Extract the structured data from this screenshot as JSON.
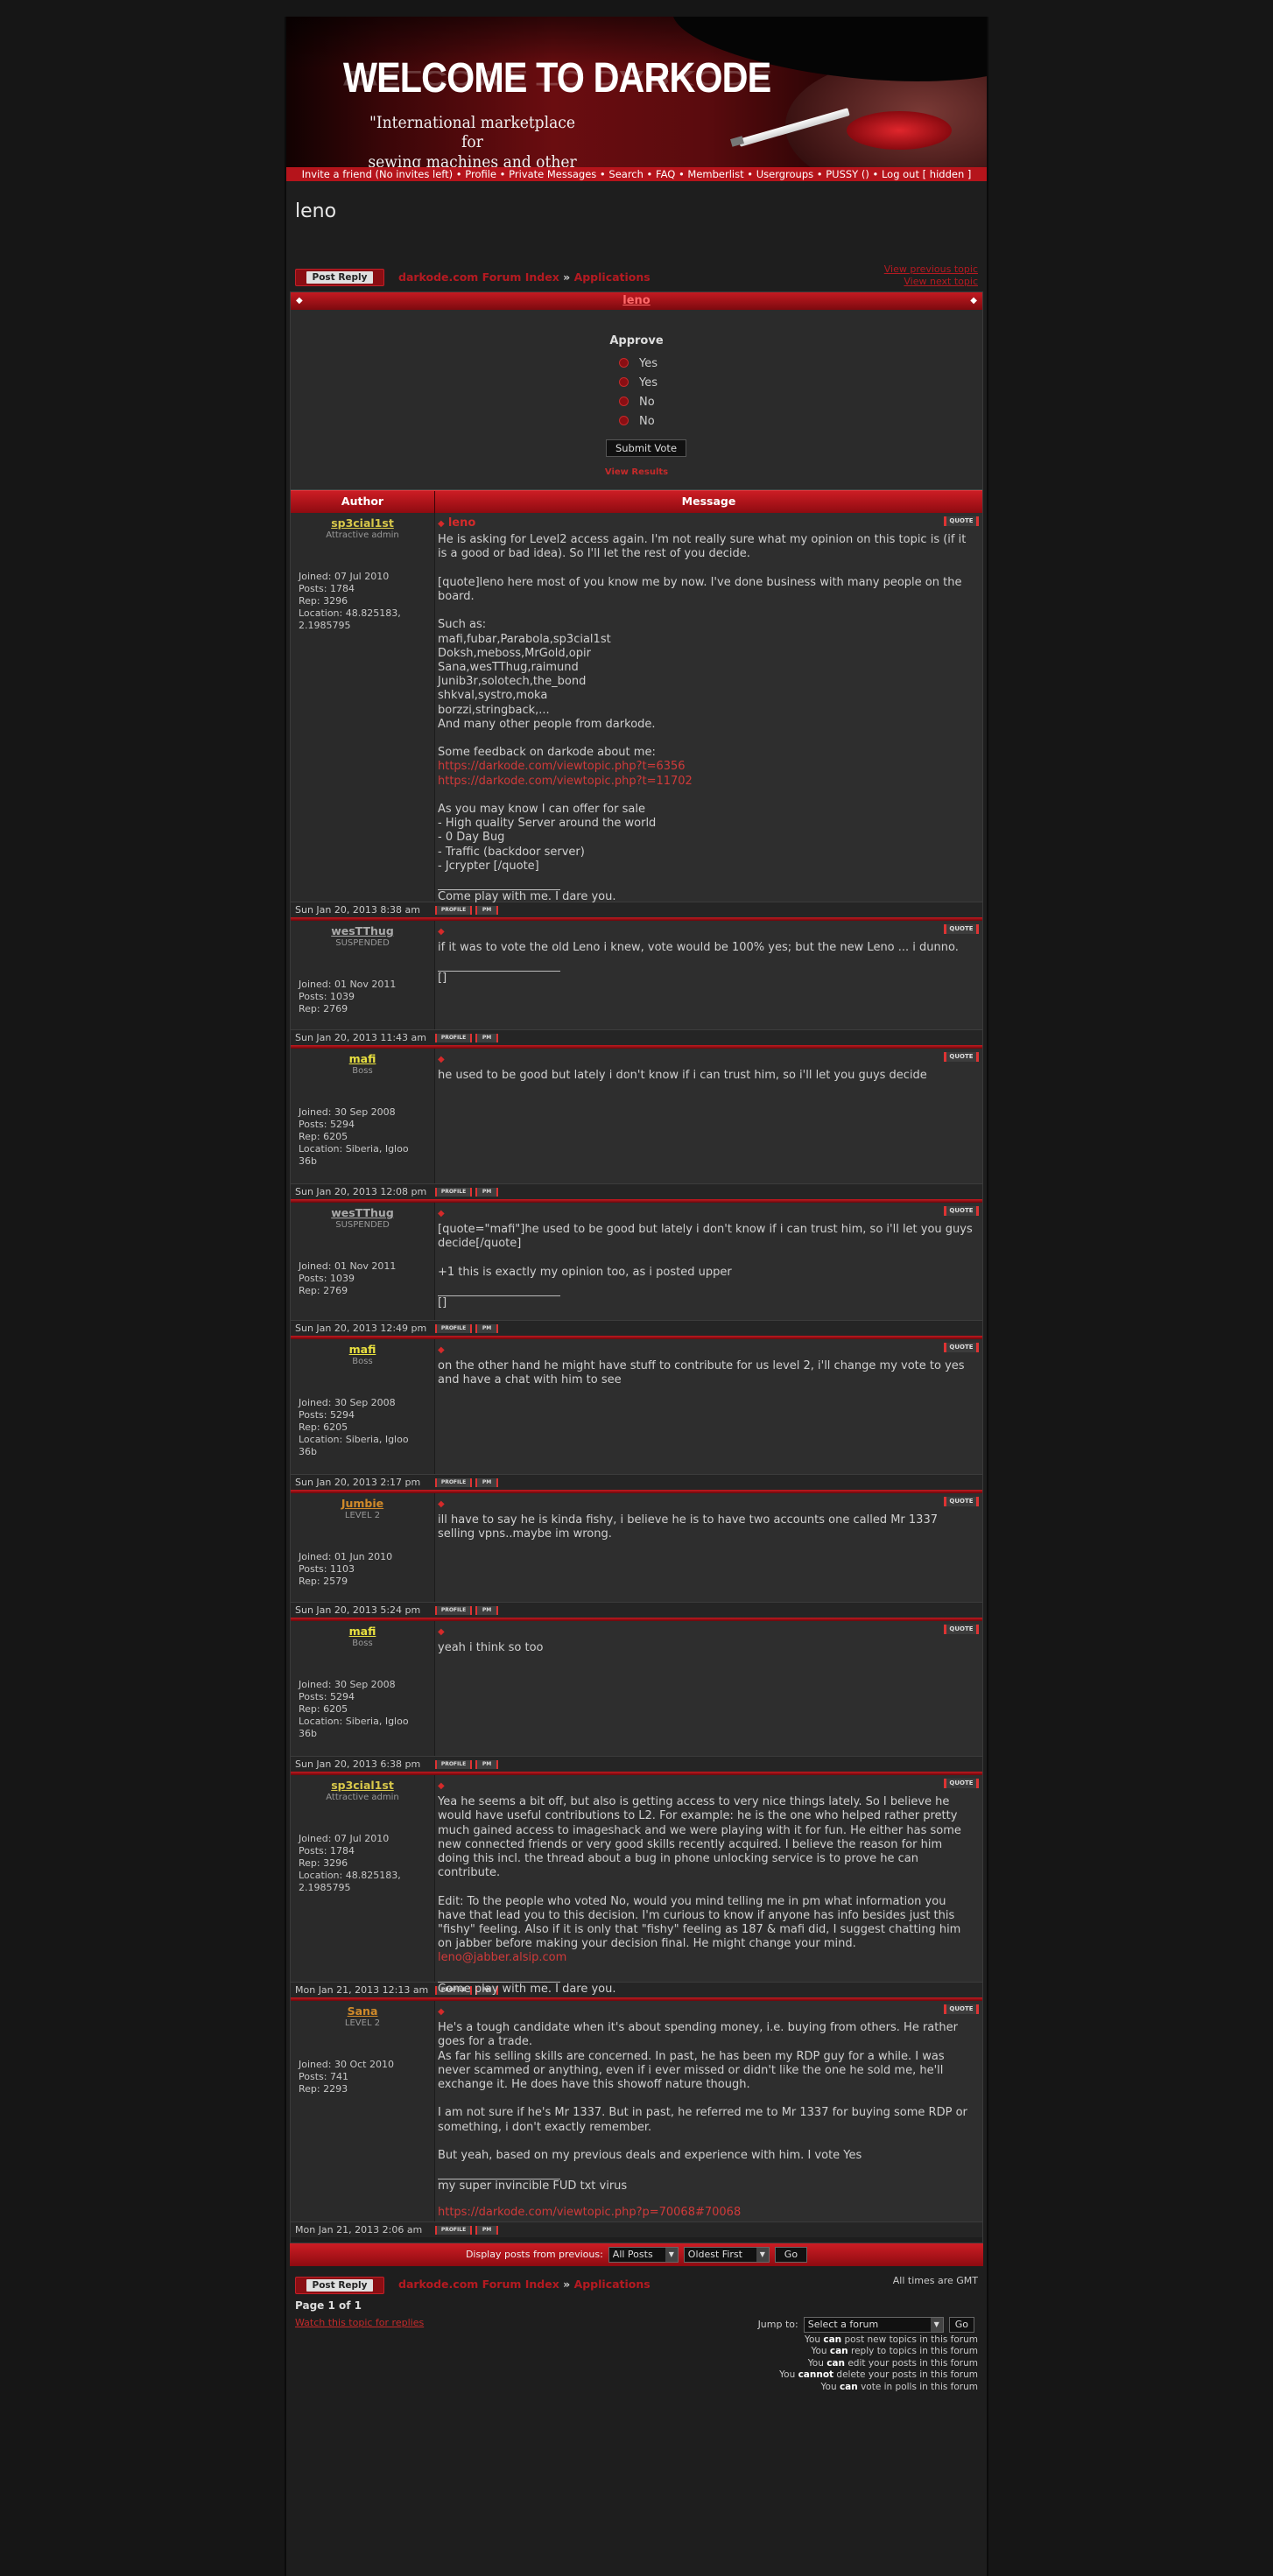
{
  "banner": {
    "title": "WELCOME TO DARKODE",
    "subtitle_1": "\"International marketplace for",
    "subtitle_2": "sewing machines and other legal stuff\""
  },
  "navbar": {
    "items": [
      "Invite a friend (No invites left)",
      "Profile",
      "Private Messages",
      "Search",
      "FAQ",
      "Memberlist",
      "Usergroups",
      "PUSSY ()",
      "Log out [ hidden ]"
    ],
    "separator": "•"
  },
  "topic": {
    "title": "leno",
    "post_reply": "Post Reply",
    "breadcrumb_index": "darkode.com Forum Index",
    "breadcrumb_sep": "»",
    "breadcrumb_forum": "Applications",
    "prev_topic": "View previous topic",
    "next_topic": "View next topic"
  },
  "poll": {
    "header": "leno",
    "question": "Approve",
    "options": [
      "Yes",
      "Yes",
      "No",
      "No"
    ],
    "submit": "Submit Vote",
    "results_link": "View Results"
  },
  "table": {
    "author_header": "Author",
    "message_header": "Message",
    "quote_label": "QUOTE",
    "profile_label": "PROFILE",
    "pm_label": "PM"
  },
  "posts": [
    {
      "author": "sp3cial1st",
      "rank": "Attractive admin",
      "name_color": "#d8c84a",
      "info": [
        "Joined: 07 Jul 2010",
        "Posts: 1784",
        "Rep: 3296",
        "Location: 48.825183, 2.1985795"
      ],
      "subject": "leno",
      "content": "He is asking for Level2 access again. I'm not really sure what my opinion on this topic is (if it is a good or bad idea). So I'll let the rest of you decide.\n\n[quote]leno here most of you know me by now. I've done business with many people on the board.\n\nSuch as:\nmafi,fubar,Parabola,sp3cial1st\nDoksh,meboss,MrGold,opir\nSana,wesTThug,raimund\nJunib3r,solotech,the_bond\nshkval,systro,moka\nborzzi,stringback,...\nAnd many other people from darkode.\n\nSome feedback on darkode about me:",
      "links": [
        "https://darkode.com/viewtopic.php?t=6356",
        "https://darkode.com/viewtopic.php?t=11702"
      ],
      "content_after": "\nAs you may know I can offer for sale\n- High quality Server around the world\n- 0 Day Bug\n- Traffic (backdoor server)\n- Jcrypter [/quote]",
      "signature": "Come play with me. I dare you.",
      "date": "Sun Jan 20, 2013 8:38 am"
    },
    {
      "author": "wesTThug",
      "rank": "SUSPENDED",
      "name_color": "#aaaaaa",
      "info": [
        "Joined: 01 Nov 2011",
        "Posts: 1039",
        "Rep: 2769"
      ],
      "subject": "",
      "content": "if it was to vote the old Leno i knew, vote would be 100% yes; but the new Leno ... i dunno.",
      "signature": "[]",
      "date": "Sun Jan 20, 2013 11:43 am"
    },
    {
      "author": "mafi",
      "rank": "Boss",
      "name_color": "#e8e040",
      "info": [
        "Joined: 30 Sep 2008",
        "Posts: 5294",
        "Rep: 6205",
        "Location: Siberia, Igloo 36b"
      ],
      "subject": "",
      "content": "he used to be good but lately i don't know if i can trust him, so i'll let you guys decide",
      "signature": "",
      "date": "Sun Jan 20, 2013 12:08 pm"
    },
    {
      "author": "wesTThug",
      "rank": "SUSPENDED",
      "name_color": "#aaaaaa",
      "info": [
        "Joined: 01 Nov 2011",
        "Posts: 1039",
        "Rep: 2769"
      ],
      "subject": "",
      "content": "[quote=\"mafi\"]he used to be good but lately i don't know if i can trust him, so i'll let you guys decide[/quote]\n\n+1 this is exactly my opinion too, as i posted upper",
      "signature": "[]",
      "date": "Sun Jan 20, 2013 12:49 pm"
    },
    {
      "author": "mafi",
      "rank": "Boss",
      "name_color": "#e8e040",
      "info": [
        "Joined: 30 Sep 2008",
        "Posts: 5294",
        "Rep: 6205",
        "Location: Siberia, Igloo 36b"
      ],
      "subject": "",
      "content": "on the other hand he might have stuff to contribute for us level 2, i'll change my vote to yes and have a chat with him to see",
      "signature": "",
      "date": "Sun Jan 20, 2013 2:17 pm"
    },
    {
      "author": "Jumbie",
      "rank": "LEVEL 2",
      "name_color": "#d08a2a",
      "info": [
        "Joined: 01 Jun 2010",
        "Posts: 1103",
        "Rep: 2579"
      ],
      "subject": "",
      "content": "ill have to say he is kinda fishy, i believe he is to have two accounts one called Mr 1337 selling vpns..maybe im wrong.",
      "signature": "",
      "date": "Sun Jan 20, 2013 5:24 pm"
    },
    {
      "author": "mafi",
      "rank": "Boss",
      "name_color": "#e8e040",
      "info": [
        "Joined: 30 Sep 2008",
        "Posts: 5294",
        "Rep: 6205",
        "Location: Siberia, Igloo 36b"
      ],
      "subject": "",
      "content": "yeah i think so too",
      "signature": "",
      "date": "Sun Jan 20, 2013 6:38 pm"
    },
    {
      "author": "sp3cial1st",
      "rank": "Attractive admin",
      "name_color": "#d8c84a",
      "info": [
        "Joined: 07 Jul 2010",
        "Posts: 1784",
        "Rep: 3296",
        "Location: 48.825183, 2.1985795"
      ],
      "subject": "",
      "content": "Yea he seems a bit off, but also is getting access to very nice things lately. So I believe he would have useful contributions to L2. For example: he is the one who helped rather pretty much gained access to imageshack and we were playing with it for fun. He either has some new connected friends or very good skills recently acquired. I believe the reason for him doing this incl. the thread about a bug in phone unlocking service is to prove he can contribute.\n\nEdit: To the people who voted No, would you mind telling me in pm what information you have that lead you to this decision. I'm curious to know if anyone has info besides just this \"fishy\" feeling. Also if it is only that \"fishy\" feeling as 187 & mafi did, I suggest chatting him on jabber before making your decision final. He might change your mind.\n",
      "links": [
        "leno@jabber.alsip.com"
      ],
      "signature": "Come play with me. I dare you.",
      "date": "Mon Jan 21, 2013 12:13 am"
    },
    {
      "author": "Sana",
      "rank": "LEVEL 2",
      "name_color": "#d08a2a",
      "info": [
        "Joined: 30 Oct 2010",
        "Posts: 741",
        "Rep: 2293"
      ],
      "subject": "",
      "content": "He's a tough candidate when it's about spending money, i.e. buying from others. He rather goes for a trade.\nAs far his selling skills are concerned. In past, he has been my RDP guy for a while. I was never scammed or anything, even if i ever missed or didn't like the one he sold me, he'll exchange it. He does have this showoff nature though.\n\nI am not sure if he's Mr 1337. But in past, he referred me to Mr 1337 for buying some RDP or something, i don't exactly remember.\n\nBut yeah, based on my previous deals and experience with him. I vote Yes",
      "signature": "my super invincible FUD txt virus",
      "sig_link": "https://darkode.com/viewtopic.php?p=70068#70068",
      "date": "Mon Jan 21, 2013 2:06 am"
    }
  ],
  "bottom": {
    "display_label": "Display posts from previous:",
    "filter_value": "All Posts",
    "order_value": "Oldest First",
    "go": "Go",
    "timezone": "All times are GMT",
    "page_of": "Page 1 of 1",
    "watch": "Watch this topic for replies",
    "jump_label": "Jump to:",
    "jump_value": "Select a forum",
    "permissions": [
      [
        "You ",
        "can",
        " post new topics in this forum"
      ],
      [
        "You ",
        "can",
        " reply to topics in this forum"
      ],
      [
        "You ",
        "can",
        " edit your posts in this forum"
      ],
      [
        "You ",
        "cannot",
        " delete your posts in this forum"
      ],
      [
        "You ",
        "can",
        " vote in polls in this forum"
      ]
    ]
  },
  "colors": {
    "accent": "#b5141b",
    "link": "#d03a3a",
    "background": "#161616"
  }
}
